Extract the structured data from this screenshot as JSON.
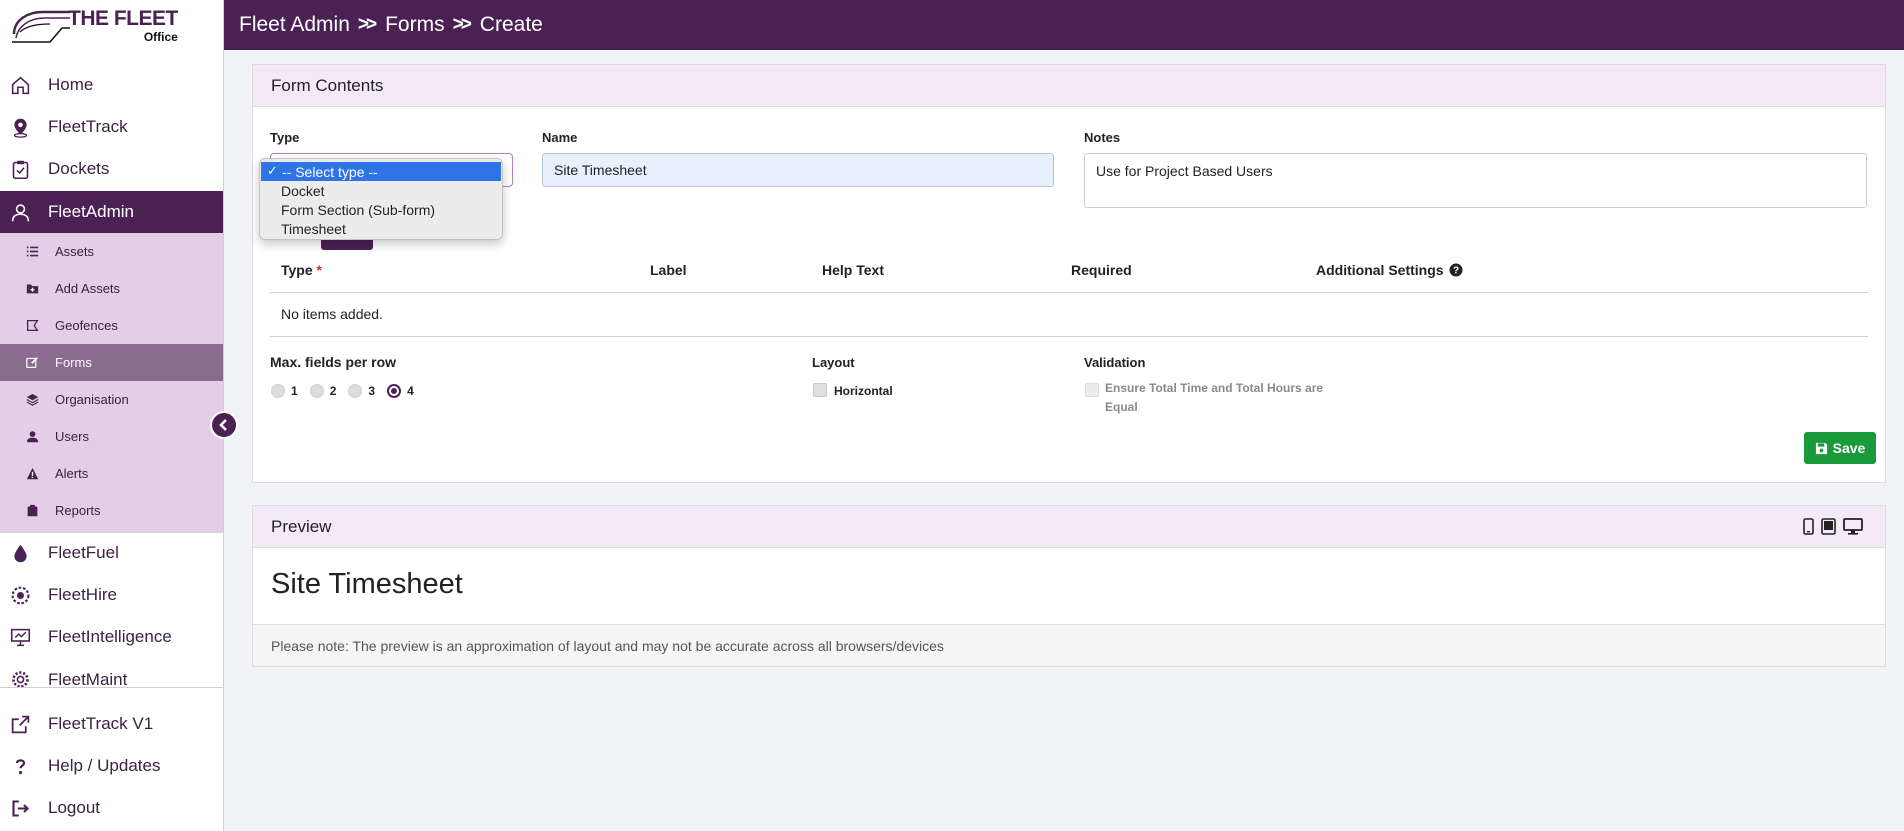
{
  "brand": {
    "title": "THE FLEET",
    "subtitle": "Office"
  },
  "breadcrumb": [
    "Fleet Admin",
    "Forms",
    "Create"
  ],
  "sidebar": {
    "items": [
      {
        "label": "Home",
        "icon": "home-icon"
      },
      {
        "label": "FleetTrack",
        "icon": "map-pin-icon"
      },
      {
        "label": "Dockets",
        "icon": "clipboard-check-icon"
      },
      {
        "label": "FleetAdmin",
        "icon": "user-gear-icon"
      },
      {
        "label": "FleetFuel",
        "icon": "fuel-drop-icon"
      },
      {
        "label": "FleetHire",
        "icon": "hire-gear-icon"
      },
      {
        "label": "FleetIntelligence",
        "icon": "presentation-icon"
      },
      {
        "label": "FleetMaint",
        "icon": "maintenance-gear-icon"
      },
      {
        "label": "FleetTrack V1",
        "icon": "external-link-icon"
      },
      {
        "label": "Help / Updates",
        "icon": "question-icon"
      },
      {
        "label": "Logout",
        "icon": "logout-icon"
      }
    ],
    "sub_items": [
      {
        "label": "Assets",
        "icon": "list-icon"
      },
      {
        "label": "Add Assets",
        "icon": "folder-plus-icon"
      },
      {
        "label": "Geofences",
        "icon": "geofence-icon"
      },
      {
        "label": "Forms",
        "icon": "edit-icon"
      },
      {
        "label": "Organisation",
        "icon": "layers-icon"
      },
      {
        "label": "Users",
        "icon": "user-icon"
      },
      {
        "label": "Alerts",
        "icon": "warning-icon"
      },
      {
        "label": "Reports",
        "icon": "clipboard-icon"
      }
    ]
  },
  "form_contents": {
    "title": "Form Contents",
    "type_label": "Type",
    "type_options": [
      "-- Select type --",
      "Docket",
      "Form Section (Sub-form)",
      "Timesheet"
    ],
    "name_label": "Name",
    "name_value": "Site Timesheet",
    "notes_label": "Notes",
    "notes_value": "Use for Project Based Users",
    "table": {
      "columns": [
        "Type",
        "Label",
        "Help Text",
        "Required",
        "Additional Settings"
      ],
      "required_marker": "*",
      "empty_text": "No items added."
    },
    "max_fields_label": "Max. fields per row",
    "max_fields_options": [
      "1",
      "2",
      "3",
      "4"
    ],
    "max_fields_selected": "4",
    "layout_label": "Layout",
    "layout_option": "Horizontal",
    "validation_label": "Validation",
    "validation_option": "Ensure Total Time and Total Hours are Equal",
    "save_label": "Save"
  },
  "preview": {
    "title": "Preview",
    "form_name": "Site Timesheet",
    "note": "Please note: The preview is an approximation of layout and may not be accurate across all browsers/devices"
  },
  "colors": {
    "brand": "#4b2154",
    "submenu_bg": "#e3cde7",
    "active_sub": "#8c6b91",
    "save": "#1a9a3a",
    "select_highlight": "#2f74e6"
  }
}
